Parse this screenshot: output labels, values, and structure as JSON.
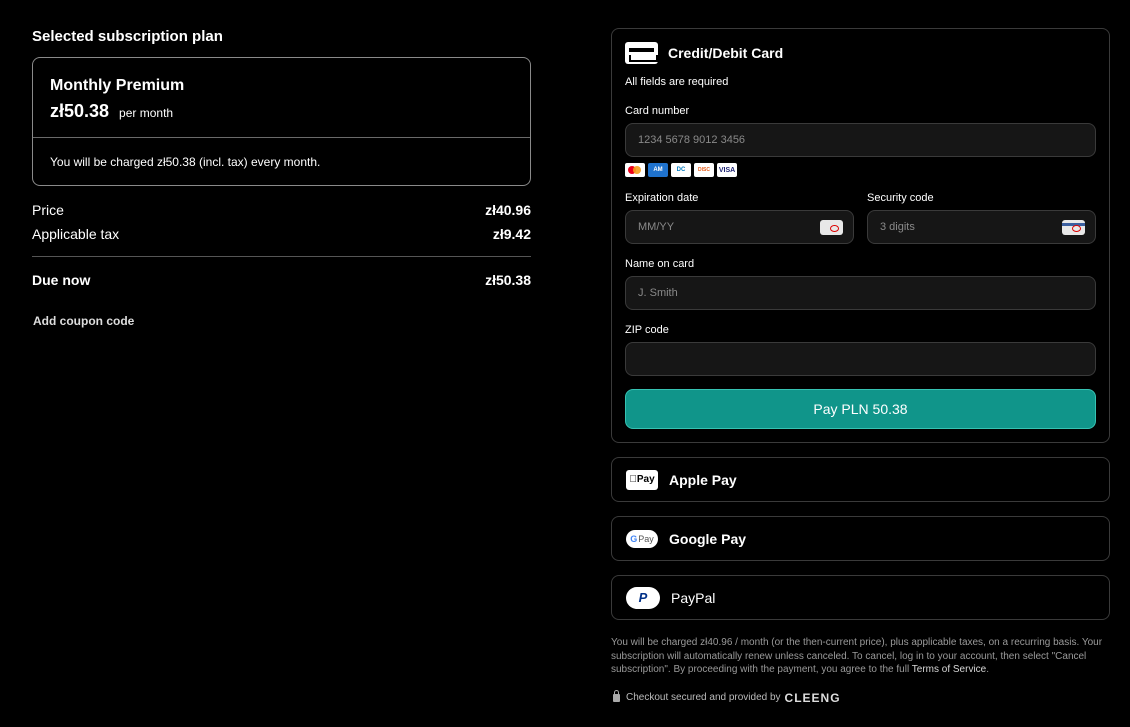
{
  "summary": {
    "section_title": "Selected subscription plan",
    "plan_name": "Monthly Premium",
    "plan_price": "zł50.38",
    "plan_period": "per month",
    "charge_note": "You will be charged zł50.38 (incl. tax) every month.",
    "price_label": "Price",
    "price_value": "zł40.96",
    "tax_label": "Applicable tax",
    "tax_value": "zł9.42",
    "due_label": "Due now",
    "due_value": "zł50.38",
    "coupon_link": "Add coupon code"
  },
  "payment": {
    "card_title": "Credit/Debit Card",
    "fields_required": "All fields are required",
    "card_number_label": "Card number",
    "card_number_placeholder": "1234 5678 9012 3456",
    "card_brands": [
      "mastercard-icon",
      "amex-icon",
      "diners-club-icon",
      "discover-icon",
      "visa-icon"
    ],
    "expiration_label": "Expiration date",
    "expiration_placeholder": "MM/YY",
    "security_label": "Security code",
    "security_placeholder": "3 digits",
    "name_label": "Name on card",
    "name_placeholder": "J. Smith",
    "zip_label": "ZIP code",
    "zip_value": "",
    "pay_button": "Pay PLN 50.38",
    "pay_button_color": "#10958a"
  },
  "methods": {
    "apple_pay": "Apple Pay",
    "google_pay": "Google Pay",
    "paypal": "PayPal"
  },
  "legal": {
    "text": "You will be charged zł40.96 / month (or the then-current price), plus applicable taxes, on a recurring basis. Your subscription will automatically renew unless canceled. To cancel, log in to your account, then select \"Cancel subscription\". By proceeding with the payment, you agree to the full ",
    "tos_link": "Terms of Service",
    "tos_suffix": ".",
    "secured_text": "Checkout secured and provided by",
    "provider_logo": "CLEENG"
  }
}
